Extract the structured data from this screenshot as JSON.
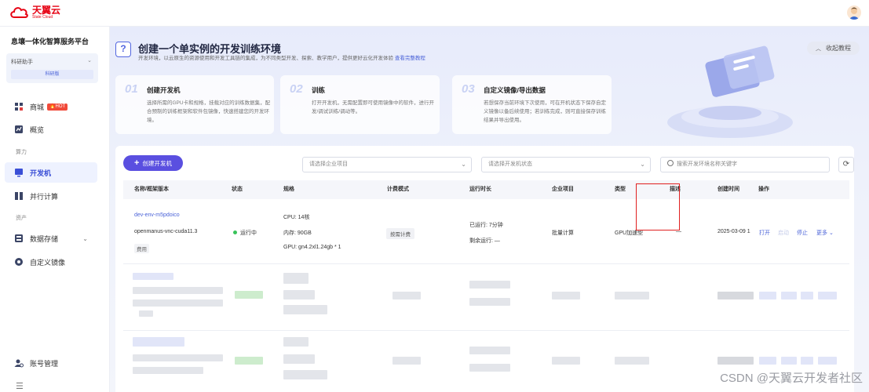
{
  "brand": {
    "name_cn": "天翼云",
    "name_en": "State Cloud",
    "accent": "#e60012"
  },
  "sidebar": {
    "platform_title": "息壤一体化智算服务平台",
    "workspace": {
      "label": "科研助手",
      "tag": "科研版"
    },
    "items": [
      {
        "label": "商城",
        "icon": "store-icon",
        "badge": "HOT"
      },
      {
        "label": "概览",
        "icon": "chart-icon"
      },
      {
        "group": "算力"
      },
      {
        "label": "开发机",
        "icon": "devbox-icon",
        "active": true
      },
      {
        "label": "并行计算",
        "icon": "parallel-icon"
      },
      {
        "group": "资产"
      },
      {
        "label": "数据存储",
        "icon": "storage-icon"
      },
      {
        "label": "自定义镜像",
        "icon": "image-icon"
      },
      {
        "label": "账号管理",
        "icon": "account-icon"
      }
    ],
    "collapse_glyph": "☰"
  },
  "hero": {
    "icon_glyph": "?",
    "title": "创建一个单实例的开发训练环境",
    "desc": "开发环境，以云原生的资源使用和开发工具链的集成，为不同类型开发、探索、教学用户，提供更好云化开发体验",
    "link": "查看完整教程",
    "collapse_label": "收起教程"
  },
  "steps": [
    {
      "num": "01",
      "title": "创建开发机",
      "desc": "选择所需的GPU卡和规格，挂载对应的训练数据集，配合预制的训练框架和软件包镜像，快速搭建您的开发环境。"
    },
    {
      "num": "02",
      "title": "训练",
      "desc": "打开开发机，无需配置即可使用镜像中的软件，进行开发/调试训练/调动等。"
    },
    {
      "num": "03",
      "title": "自定义镜像/导出数据",
      "desc": "若想保存当前环境下次使用，可在开机状态下保存自定义镜像以备后续使用；若训练完成，则可直接保存训练结果并导出使用。"
    }
  ],
  "toolbar": {
    "create_label": "创建开发机",
    "project_placeholder": "请选择企业项目",
    "status_placeholder": "请选择开发机状态",
    "search_placeholder": "搜索开发环境名称关键字",
    "refresh_glyph": "⟳"
  },
  "table": {
    "columns": [
      "名称/框架版本",
      "状态",
      "规格",
      "计费模式",
      "运行时长",
      "企业项目",
      "类型",
      "描述",
      "创建时间",
      "操作"
    ],
    "rows": [
      {
        "name": "dev-env-m5pdoico",
        "framework": "openmanus-vnc-cuda11.3",
        "note": "费用",
        "status": "运行中",
        "spec_cpu": "CPU: 14核",
        "spec_mem": "内存: 90GB",
        "spec_gpu": "GPU: gn4.2xl1.24gb * 1",
        "billing": "按需计费",
        "runtime_used": "已运行: 7分钟",
        "runtime_left": "剩余运行: —",
        "project": "批量计算",
        "type": "GPU加速型",
        "desc": "—",
        "created": "2025-03-09 1",
        "ops": [
          "打开",
          "启动",
          "停止",
          "更多"
        ]
      }
    ]
  },
  "watermark": "CSDN @天翼云开发者社区"
}
